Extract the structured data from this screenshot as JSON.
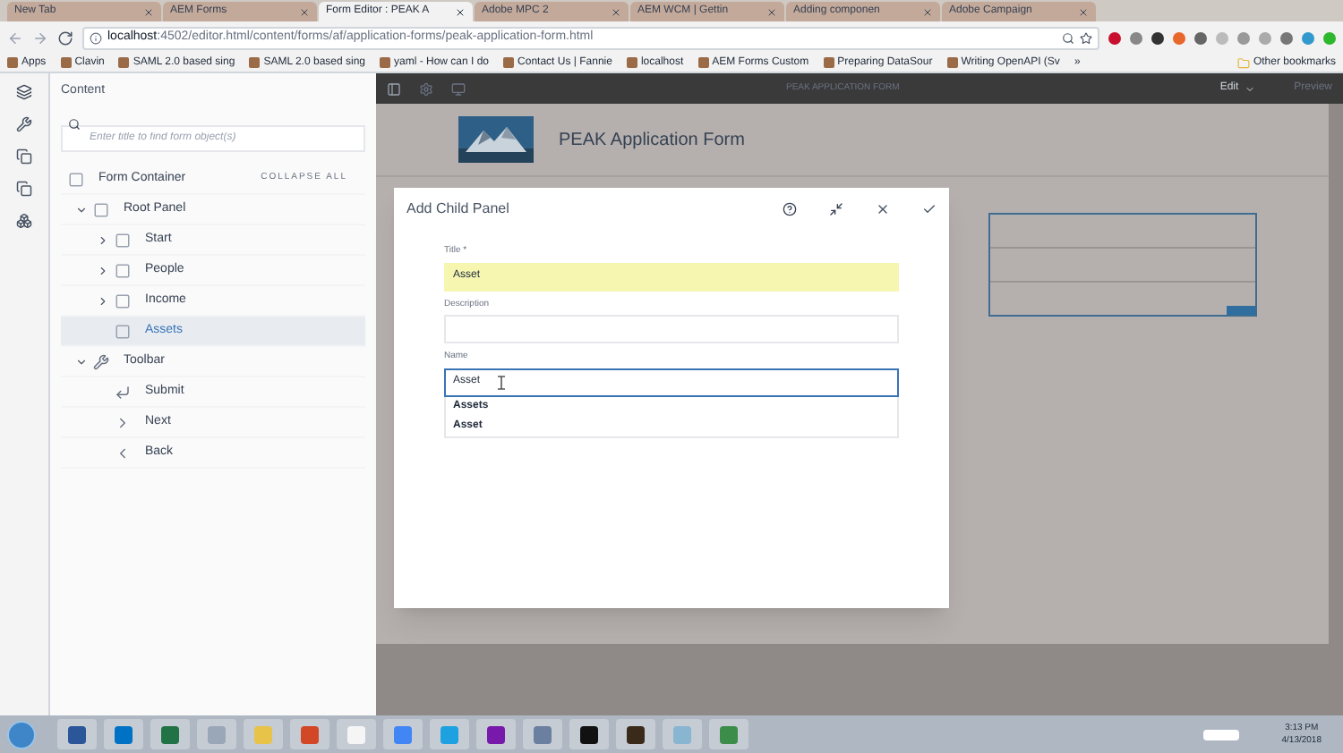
{
  "browser": {
    "tabs": [
      {
        "label": "New Tab",
        "selected": false
      },
      {
        "label": "AEM Forms",
        "selected": false
      },
      {
        "label": "Form Editor : PEAK A",
        "selected": true
      },
      {
        "label": "Adobe MPC 2",
        "selected": false
      },
      {
        "label": "AEM WCM | Gettin",
        "selected": false
      },
      {
        "label": "Adding componen",
        "selected": false
      },
      {
        "label": "Adobe Campaign",
        "selected": false
      }
    ],
    "address": {
      "host": "localhost",
      "path": ":4502/editor.html/content/forms/af/application-forms/peak-application-form.html"
    },
    "bookmarks": [
      "Apps",
      "Clavin",
      "SAML 2.0 based sing",
      "SAML 2.0 based sing",
      "yaml - How can I do",
      "Contact Us | Fannie",
      "localhost",
      "AEM Forms Custom",
      "Preparing DataSour",
      "Writing OpenAPI (Sv"
    ],
    "more_bookmarks": "»",
    "other_bookmarks": "Other bookmarks"
  },
  "sidebar": {
    "title": "Content",
    "search": {
      "placeholder": "Enter title to find form object(s)"
    },
    "collapse_all": "COLLAPSE ALL",
    "tree": [
      {
        "label": "Form Container",
        "kind": "container",
        "selected": false,
        "children": [
          {
            "label": "Root Panel",
            "kind": "panel",
            "selected": false,
            "expanded": true,
            "children": [
              {
                "label": "Start",
                "kind": "panel",
                "selected": false,
                "expanded": false
              },
              {
                "label": "People",
                "kind": "panel",
                "selected": false,
                "expanded": false
              },
              {
                "label": "Income",
                "kind": "panel",
                "selected": false,
                "expanded": false
              },
              {
                "label": "Assets",
                "kind": "panel",
                "selected": true
              }
            ]
          },
          {
            "label": "Toolbar",
            "kind": "toolbar",
            "selected": false,
            "expanded": true,
            "children": [
              {
                "label": "Submit",
                "kind": "submit",
                "selected": false
              },
              {
                "label": "Next",
                "kind": "next",
                "selected": false
              },
              {
                "label": "Back",
                "kind": "back",
                "selected": false
              }
            ]
          }
        ]
      }
    ]
  },
  "editor": {
    "title": "PEAK APPLICATION FORM",
    "mode": "Edit",
    "preview": "Preview",
    "form_title": "PEAK Application Form"
  },
  "dialog": {
    "title": "Add Child Panel",
    "fields": [
      {
        "label": "Title *",
        "value": "Asset",
        "highlighted": true,
        "focused": false
      },
      {
        "label": "Description",
        "highlighted": false,
        "focused": false
      },
      {
        "label": "Name",
        "value": "Asset",
        "highlighted": false,
        "focused": true,
        "suggestions": [
          "Assets",
          "Asset"
        ]
      }
    ]
  },
  "taskbar": {
    "time": "3:13 PM",
    "date": "4/13/2018"
  }
}
